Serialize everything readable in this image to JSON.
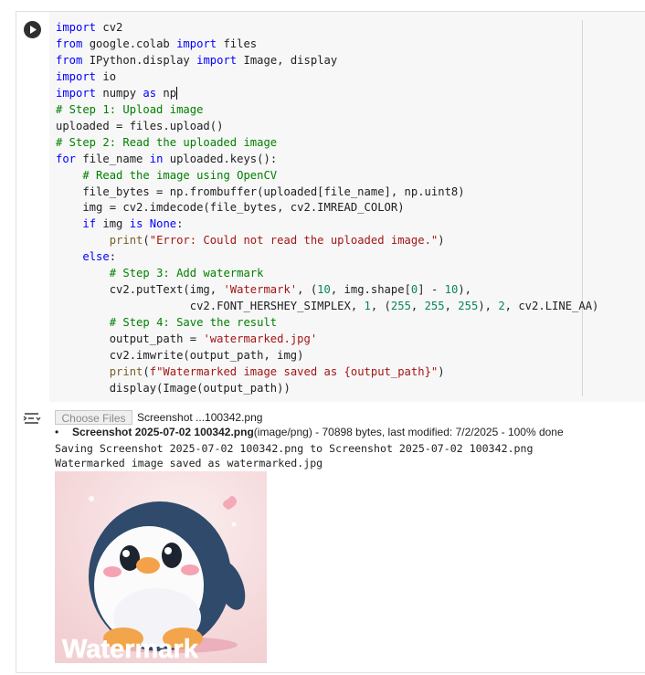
{
  "code": {
    "lines": [
      [
        [
          "k",
          "import"
        ],
        [
          "p",
          " cv2"
        ]
      ],
      [
        [
          "k",
          "from"
        ],
        [
          "p",
          " google.colab "
        ],
        [
          "k",
          "import"
        ],
        [
          "p",
          " files"
        ]
      ],
      [
        [
          "k",
          "from"
        ],
        [
          "p",
          " IPython.display "
        ],
        [
          "k",
          "import"
        ],
        [
          "p",
          " Image, display"
        ]
      ],
      [
        [
          "k",
          "import"
        ],
        [
          "p",
          " io"
        ]
      ],
      [
        [
          "k",
          "import"
        ],
        [
          "p",
          " numpy "
        ],
        [
          "k",
          "as"
        ],
        [
          "p",
          " np"
        ],
        [
          "cursor",
          ""
        ]
      ],
      [
        [
          "c",
          "# Step 1: Upload image"
        ]
      ],
      [
        [
          "p",
          "uploaded = files.upload()"
        ]
      ],
      [
        [
          "c",
          "# Step 2: Read the uploaded image"
        ]
      ],
      [
        [
          "k",
          "for"
        ],
        [
          "p",
          " file_name "
        ],
        [
          "k",
          "in"
        ],
        [
          "p",
          " uploaded.keys():"
        ]
      ],
      [
        [
          "p",
          "    "
        ],
        [
          "c",
          "# Read the image using OpenCV"
        ]
      ],
      [
        [
          "p",
          "    file_bytes = np.frombuffer(uploaded[file_name], np.uint8)"
        ]
      ],
      [
        [
          "p",
          "    img = cv2.imdecode(file_bytes, cv2.IMREAD_COLOR)"
        ]
      ],
      [
        [
          "p",
          "    "
        ],
        [
          "k",
          "if"
        ],
        [
          "p",
          " img "
        ],
        [
          "k",
          "is"
        ],
        [
          "p",
          " "
        ],
        [
          "k",
          "None"
        ],
        [
          "p",
          ":"
        ]
      ],
      [
        [
          "p",
          "        "
        ],
        [
          "b",
          "print"
        ],
        [
          "p",
          "("
        ],
        [
          "s",
          "\"Error: Could not read the uploaded image.\""
        ],
        [
          "p",
          ")"
        ]
      ],
      [
        [
          "p",
          "    "
        ],
        [
          "k",
          "else"
        ],
        [
          "p",
          ":"
        ]
      ],
      [
        [
          "p",
          "        "
        ],
        [
          "c",
          "# Step 3: Add watermark"
        ]
      ],
      [
        [
          "p",
          "        cv2.putText(img, "
        ],
        [
          "s",
          "'Watermark'"
        ],
        [
          "p",
          ", ("
        ],
        [
          "n",
          "10"
        ],
        [
          "p",
          ", img.shape["
        ],
        [
          "n",
          "0"
        ],
        [
          "p",
          "] - "
        ],
        [
          "n",
          "10"
        ],
        [
          "p",
          "),"
        ]
      ],
      [
        [
          "p",
          "                    cv2.FONT_HERSHEY_SIMPLEX, "
        ],
        [
          "n",
          "1"
        ],
        [
          "p",
          ", ("
        ],
        [
          "n",
          "255"
        ],
        [
          "p",
          ", "
        ],
        [
          "n",
          "255"
        ],
        [
          "p",
          ", "
        ],
        [
          "n",
          "255"
        ],
        [
          "p",
          "), "
        ],
        [
          "n",
          "2"
        ],
        [
          "p",
          ", cv2.LINE_AA)"
        ]
      ],
      [
        [
          "p",
          "        "
        ],
        [
          "c",
          "# Step 4: Save the result"
        ]
      ],
      [
        [
          "p",
          "        output_path = "
        ],
        [
          "s",
          "'watermarked.jpg'"
        ]
      ],
      [
        [
          "p",
          "        cv2.imwrite(output_path, img)"
        ]
      ],
      [
        [
          "p",
          "        "
        ],
        [
          "b",
          "print"
        ],
        [
          "p",
          "("
        ],
        [
          "s",
          "f\"Watermarked image saved as {output_path}\""
        ],
        [
          "p",
          ")"
        ]
      ],
      [
        [
          "p",
          "        display(Image(output_path))"
        ]
      ]
    ]
  },
  "output": {
    "choose_files_label": "Choose Files",
    "chosen_file": "Screenshot ...100342.png",
    "file_name": "Screenshot 2025-07-02 100342.png",
    "file_details": "(image/png) - 70898 bytes, last modified: 7/2/2025 - 100% done",
    "stdout_lines": [
      "Saving Screenshot 2025-07-02 100342.png to Screenshot 2025-07-02 100342.png",
      "Watermarked image saved as watermarked.jpg"
    ],
    "image_watermark_text": "Watermark"
  },
  "colors": {
    "keyword": "#0000ff",
    "comment": "#008000",
    "string": "#a31515",
    "number": "#098658",
    "builtin": "#795e26",
    "editor_bg": "#f7f7f7",
    "image_bg": "#f6dcdc",
    "penguin_body": "#2f4a6b"
  },
  "icons": {
    "run": "play-circle-icon",
    "output_toggle": "output-collapse-icon"
  }
}
